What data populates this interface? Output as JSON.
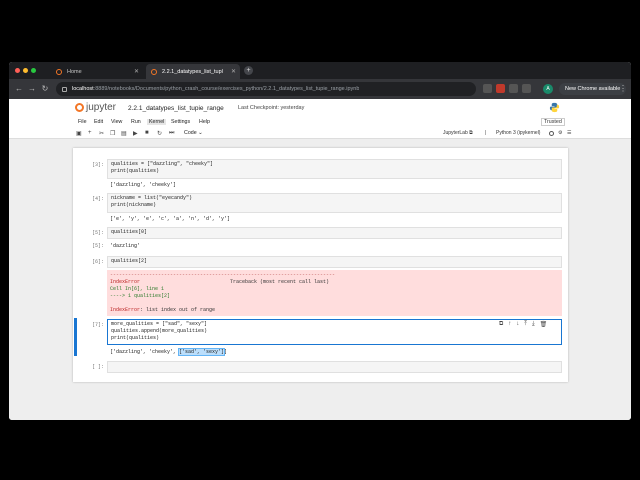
{
  "browser": {
    "tabs": [
      {
        "label": "Home",
        "active": false
      },
      {
        "label": "2.2.1_datatypes_list_tupl",
        "active": true
      }
    ],
    "url_host": "localhost",
    "url_path": ":8889/notebooks/Documents/python_crash_course/exercises_python/2.2.1_datatypes_list_tupie_range.ipynb",
    "new_chrome": "New Chrome available",
    "avatar_letter": "A"
  },
  "jupyter": {
    "logo_text": "jupyter",
    "notebook_title": "2.2.1_datatypes_list_tupie_range",
    "checkpoint": "Last Checkpoint: yesterday",
    "menus": [
      "File",
      "Edit",
      "View",
      "Run",
      "Kernel",
      "Settings",
      "Help"
    ],
    "active_menu": "Kernel",
    "trusted": "Trusted",
    "cell_type": "Code",
    "jupyterlab_label": "JupyterLab",
    "kernel_name": "Python 3 (ipykernel)"
  },
  "cells": [
    {
      "prompt": "[3]:",
      "code": [
        "qualities = [\"dazzling\", \"cheeky\"]",
        "print(qualities)"
      ],
      "output": "['dazzling', 'cheeky']"
    },
    {
      "prompt": "[4]:",
      "code": [
        "nickname = list(\"eyecandy\")",
        "print(nickname)"
      ],
      "output": "['e', 'y', 'e', 'c', 'a', 'n', 'd', 'y']"
    },
    {
      "prompt": "[5]:",
      "code": [
        "qualities[0]"
      ],
      "out_prompt": "[5]:",
      "output": "'dazzling'"
    },
    {
      "prompt": "[6]:",
      "code": [
        "qualities[2]"
      ]
    },
    {
      "prompt": "[7]:",
      "code": [
        "more_qualities = [\"sad\", \"sexy\"]",
        "qualities.append(more_qualities)",
        "print(qualities)"
      ],
      "output_prefix": "['dazzling', 'cheeky', ",
      "output_selected": "['sad', 'sexy']",
      "output_suffix": "]"
    },
    {
      "prompt": "[ ]:",
      "code": [
        ""
      ]
    }
  ],
  "error": {
    "rule": "---------------------------------------------------------------------------",
    "name": "IndexError",
    "traceback": "Traceback (most recent call last)",
    "cell_ref": "Cell In[6], line 1",
    "arrow_line": "----> 1 qualities[2]",
    "message_name": "IndexError",
    "message": ": list index out of range"
  }
}
